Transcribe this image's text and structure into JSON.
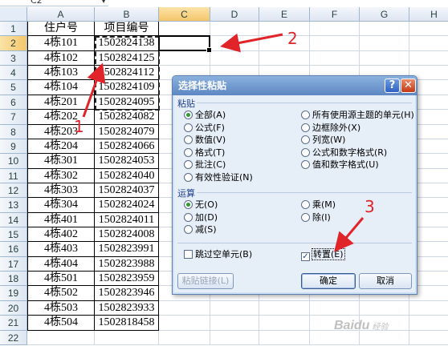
{
  "name_box": {
    "value": "C2",
    "dropdown_glyph": "▼"
  },
  "columns": [
    "A",
    "B",
    "C",
    "D",
    "E",
    "F",
    "G",
    "H"
  ],
  "rows": [
    "1",
    "2",
    "3",
    "4",
    "5",
    "6",
    "7",
    "8",
    "9",
    "10",
    "11",
    "12",
    "13",
    "14",
    "15",
    "16",
    "17",
    "18",
    "19",
    "20",
    "21",
    "22"
  ],
  "table": {
    "headers": [
      "住户号",
      "项目编号"
    ],
    "rows": [
      [
        "4栋101",
        "1502824138"
      ],
      [
        "4栋102",
        "1502824125"
      ],
      [
        "4栋103",
        "1502824112"
      ],
      [
        "4栋104",
        "1502824109"
      ],
      [
        "4栋201",
        "1502824095"
      ],
      [
        "4栋202",
        "1502824082"
      ],
      [
        "4栋203",
        "1502824079"
      ],
      [
        "4栋204",
        "1502824066"
      ],
      [
        "4栋301",
        "1502824053"
      ],
      [
        "4栋302",
        "1502824040"
      ],
      [
        "4栋303",
        "1502824037"
      ],
      [
        "4栋304",
        "1502824024"
      ],
      [
        "4栋401",
        "1502824011"
      ],
      [
        "4栋402",
        "1502824008"
      ],
      [
        "4栋403",
        "1502823991"
      ],
      [
        "4栋404",
        "1502823988"
      ],
      [
        "4栋501",
        "1502823959"
      ],
      [
        "4栋502",
        "1502823946"
      ],
      [
        "4栋503",
        "1502823933"
      ],
      [
        "4栋504",
        "1502818458"
      ]
    ]
  },
  "dialog": {
    "title": "选择性粘贴",
    "help_glyph": "?",
    "close_glyph": "✕",
    "paste_group": "粘贴",
    "paste_left": [
      "全部(A)",
      "公式(F)",
      "数值(V)",
      "格式(T)",
      "批注(C)",
      "有效性验证(N)"
    ],
    "paste_right": [
      "所有使用源主题的单元(H)",
      "边框除外(X)",
      "列宽(W)",
      "公式和数字格式(R)",
      "值和数字格式(U)"
    ],
    "op_group": "运算",
    "op_left": [
      "无(O)",
      "加(D)",
      "减(S)"
    ],
    "op_right": [
      "乘(M)",
      "除(I)"
    ],
    "skip_blanks": "跳过空单元(B)",
    "transpose": "转置(E)",
    "paste_link": "粘贴链接(L)",
    "ok": "确定",
    "cancel": "取消"
  },
  "annotations": {
    "step1": "1",
    "step2": "2",
    "step3": "3",
    "accent_color": "#e0242a"
  },
  "watermark": {
    "brand": "Bai",
    "paw": "du",
    "sub": "经验"
  }
}
